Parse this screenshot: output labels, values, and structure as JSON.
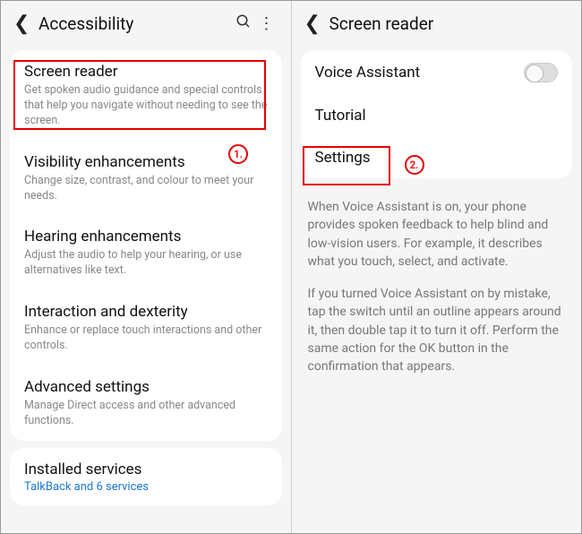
{
  "left": {
    "title": "Accessibility",
    "items": [
      {
        "title": "Screen reader",
        "sub": "Get spoken audio guidance and special controls that help you navigate without needing to see the screen."
      },
      {
        "title": "Visibility enhancements",
        "sub": "Change size, contrast, and colour to meet your needs."
      },
      {
        "title": "Hearing enhancements",
        "sub": "Adjust the audio to help your hearing, or use alternatives like text."
      },
      {
        "title": "Interaction and dexterity",
        "sub": "Enhance or replace touch interactions and other controls."
      },
      {
        "title": "Advanced settings",
        "sub": "Manage Direct access and other advanced functions."
      }
    ],
    "installed": {
      "title": "Installed services",
      "sub": "TalkBack and 6 services"
    },
    "badge": "1."
  },
  "right": {
    "title": "Screen reader",
    "voice_assistant": "Voice Assistant",
    "tutorial": "Tutorial",
    "settings": "Settings",
    "badge": "2.",
    "desc1": "When Voice Assistant is on, your phone provides spoken feedback to help blind and low-vision users. For example, it describes what you touch, select, and activate.",
    "desc2": "If you turned Voice Assistant on by mistake, tap the switch until an outline appears around it, then double tap it to turn it off. Perform the same action for the OK button in the confirmation that appears."
  }
}
